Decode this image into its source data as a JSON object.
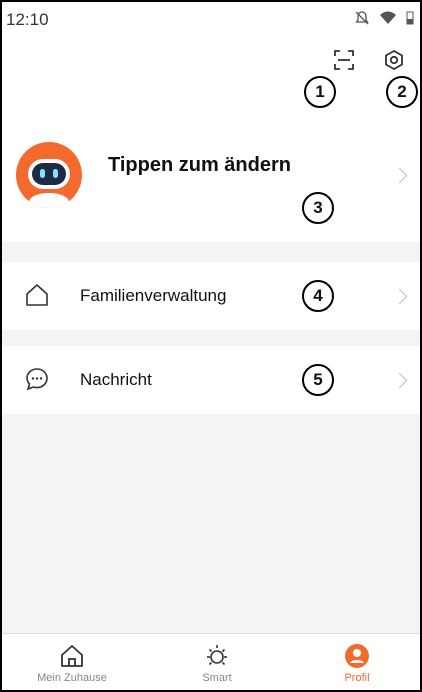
{
  "status_bar": {
    "time": "12:10"
  },
  "header": {
    "scan_icon": "scan-icon",
    "settings_icon": "settings-hex-icon"
  },
  "profile": {
    "name": "Tippen zum ändern",
    "avatar": "robot-avatar"
  },
  "menu": [
    {
      "label": "Familienverwaltung",
      "icon": "home-outline-icon"
    },
    {
      "label": "Nachricht",
      "icon": "chat-bubble-icon"
    }
  ],
  "annotations": [
    "1",
    "2",
    "3",
    "4",
    "5"
  ],
  "bottom_nav": [
    {
      "label": "Mein Zuhause",
      "icon": "home-icon",
      "active": false
    },
    {
      "label": "Smart",
      "icon": "sun-icon",
      "active": false
    },
    {
      "label": "Profil",
      "icon": "profile-icon",
      "active": true
    }
  ],
  "colors": {
    "accent": "#f26a2e",
    "background": "#f4f4f4"
  }
}
